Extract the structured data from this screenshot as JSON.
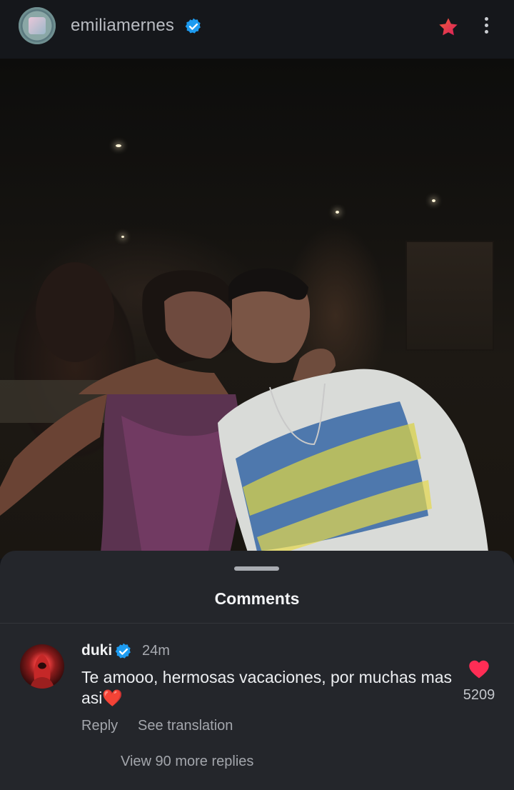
{
  "header": {
    "username": "emiliamernes",
    "icons": [
      "verified-badge-icon",
      "star-icon",
      "more-vertical-icon"
    ],
    "star_color": "#e0342f"
  },
  "photo": {
    "kind": "photo"
  },
  "comments_sheet": {
    "title": "Comments",
    "comment": {
      "username": "duki",
      "time": "24m",
      "text": "Te amooo, hermosas vacaciones, por muchas mas asi❤️",
      "reply_label": "Reply",
      "translate_label": "See translation",
      "likes": "5209",
      "heart_color": "#ff2d55"
    },
    "view_replies_label": "View 90 more replies"
  },
  "colors": {
    "background": "#121418",
    "sheet": "#24262b",
    "verified": "#1d9bf0"
  }
}
